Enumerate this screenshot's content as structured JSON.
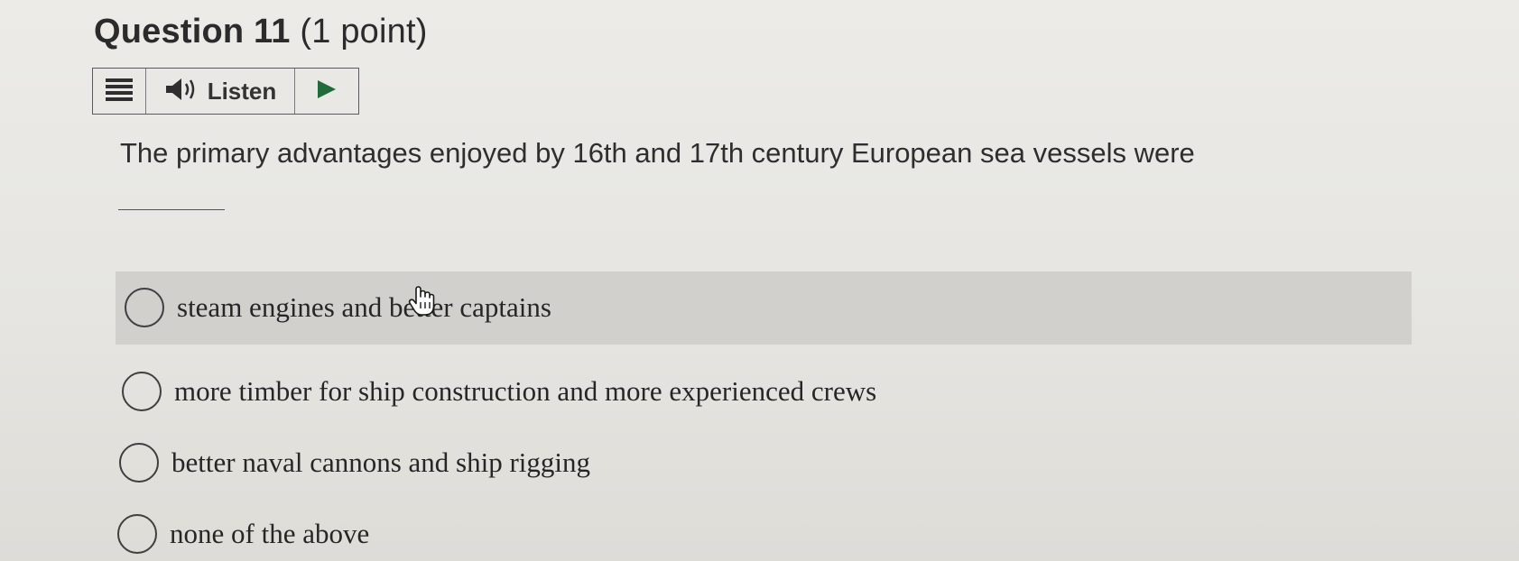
{
  "question": {
    "title_number": "Question 11",
    "title_points": "(1 point)",
    "prompt": "The primary advantages enjoyed by 16th and 17th century European sea vessels were"
  },
  "listen_toolbar": {
    "menu_icon": "hamburger-menu-icon",
    "speaker_icon": "speaker-icon",
    "listen_label": "Listen",
    "play_icon": "play-icon"
  },
  "options": [
    {
      "label": "steam engines and better captains",
      "selected": false,
      "hovered": true
    },
    {
      "label": "more timber for ship construction and more experienced crews",
      "selected": false,
      "hovered": false
    },
    {
      "label": "better naval cannons and ship rigging",
      "selected": false,
      "hovered": false
    },
    {
      "label": "none of the above",
      "selected": false,
      "hovered": false
    }
  ],
  "colors": {
    "hover_row": "#d2d0cc",
    "play_triangle": "#1f6b3a"
  }
}
